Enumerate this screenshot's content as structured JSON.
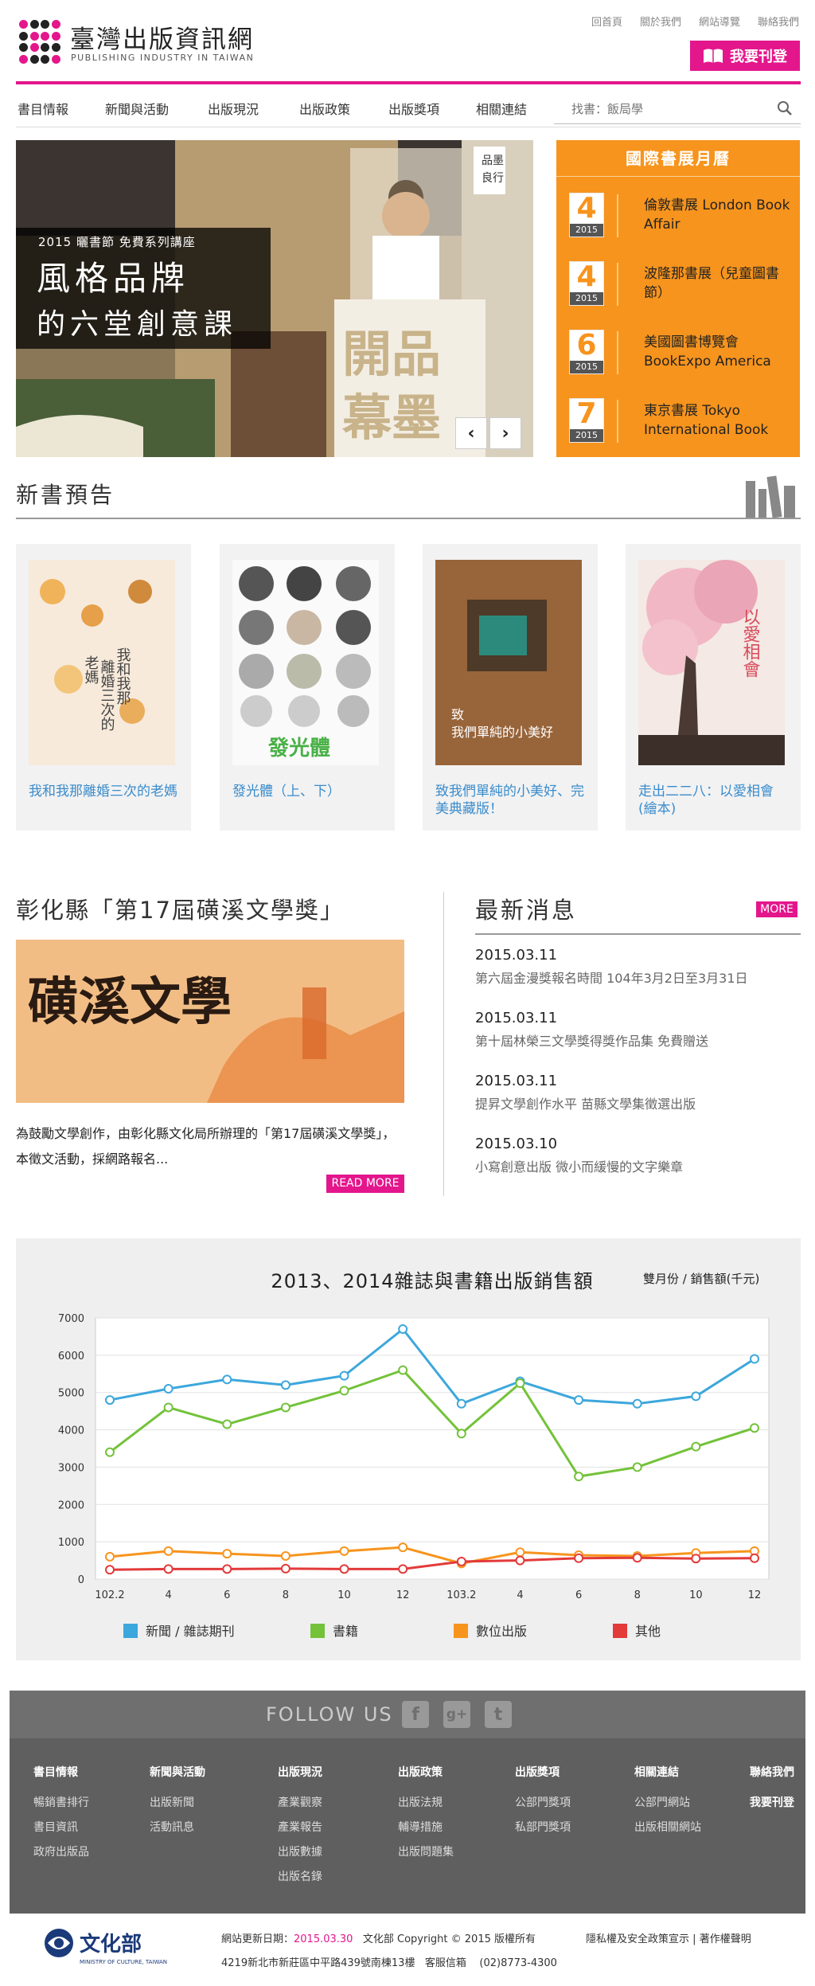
{
  "header": {
    "title": "臺灣出版資訊網",
    "subtitle": "PUBLISHING INDUSTRY IN TAIWAN",
    "toplinks": [
      "回首頁",
      "關於我們",
      "網站導覽",
      "聯絡我們"
    ],
    "subscribe_label": "我要刊登",
    "brand_color": "#e4168c"
  },
  "nav": {
    "items": [
      "書目情報",
      "新聞與活動",
      "出版現況",
      "出版政策",
      "出版獎項",
      "相關連結"
    ],
    "search_placeholder": "找書：飯局學"
  },
  "hero": {
    "tag": "2015 曬書節 免費系列講座",
    "title_line1": "風格品牌",
    "title_line2": "的六堂創意課",
    "prev_label": "‹",
    "next_label": "›"
  },
  "book_fair": {
    "title": "國際書展月曆",
    "accent": "#f7941d",
    "items": [
      {
        "month": "4",
        "year": "2015",
        "name": "倫敦書展 London Book Affair"
      },
      {
        "month": "4",
        "year": "2015",
        "name": "波隆那書展（兒童圖書節）"
      },
      {
        "month": "6",
        "year": "2015",
        "name": "美國圖書博覽會 BookExpo America"
      },
      {
        "month": "7",
        "year": "2015",
        "name": "東京書展 Tokyo International Book"
      }
    ]
  },
  "new_books": {
    "title": "新書預告",
    "items": [
      {
        "caption": "我和我那離婚三次的老媽"
      },
      {
        "caption": "發光體（上、下）"
      },
      {
        "caption": "致我們單純的小美好、完美典藏版！"
      },
      {
        "caption": "走出二二八：以愛相會(繪本)"
      }
    ]
  },
  "award": {
    "title": "彰化縣「第17屆磺溪文學獎」",
    "image_text": "磺溪文學",
    "text": "為鼓勵文學創作，由彰化縣文化局所辦理的「第17屆磺溪文學獎」，本徵文活動，採網路報名...",
    "more_label": "READ MORE"
  },
  "news": {
    "title": "最新消息",
    "more_label": "MORE",
    "items": [
      {
        "date": "2015.03.11",
        "text": "第六屆金漫獎報名時間 104年3月2日至3月31日"
      },
      {
        "date": "2015.03.11",
        "text": "第十屆林榮三文學獎得獎作品集 免費贈送"
      },
      {
        "date": "2015.03.11",
        "text": "提昇文學創作水平 苗縣文學集徵選出版"
      },
      {
        "date": "2015.03.10",
        "text": "小寫創意出版 微小而緩慢的文字樂章"
      }
    ]
  },
  "chart_data": {
    "type": "line",
    "title": "2013、2014雜誌與書籍出版銷售額",
    "unit_label": "雙月份 / 銷售額(千元)",
    "x": [
      "102.2",
      "4",
      "6",
      "8",
      "10",
      "12",
      "103.2",
      "4",
      "6",
      "8",
      "10",
      "12"
    ],
    "ylim": [
      0,
      7000
    ],
    "yticks": [
      0,
      1000,
      2000,
      3000,
      4000,
      5000,
      6000,
      7000
    ],
    "grid": true,
    "legend_position": "bottom",
    "series": [
      {
        "name": "新聞 / 雜誌期刊",
        "color": "#3ca7dc",
        "values": [
          4800,
          5100,
          5350,
          5200,
          5450,
          6700,
          4700,
          5300,
          4800,
          4700,
          4900,
          5900
        ]
      },
      {
        "name": "書籍",
        "color": "#73c23a",
        "values": [
          3400,
          4600,
          4150,
          4600,
          5050,
          5600,
          3900,
          5250,
          2750,
          3000,
          3550,
          4050
        ]
      },
      {
        "name": "數位出版",
        "color": "#f7941d",
        "values": [
          600,
          750,
          680,
          620,
          750,
          850,
          420,
          720,
          640,
          620,
          700,
          750
        ]
      },
      {
        "name": "其他",
        "color": "#e33a3a",
        "values": [
          250,
          270,
          270,
          280,
          270,
          270,
          470,
          500,
          560,
          570,
          550,
          560
        ]
      }
    ]
  },
  "footer": {
    "follow_label": "FOLLOW US",
    "social": [
      "f",
      "g+",
      "t"
    ],
    "columns": [
      {
        "heading": "書目情報",
        "links": [
          "暢銷書排行",
          "書目資訊",
          "政府出版品"
        ]
      },
      {
        "heading": "新聞與活動",
        "links": [
          "出版新聞",
          "活動訊息"
        ]
      },
      {
        "heading": "出版現況",
        "links": [
          "產業觀察",
          "產業報告",
          "出版數據",
          "出版名錄"
        ]
      },
      {
        "heading": "出版政策",
        "links": [
          "出版法規",
          "輔導措施",
          "出版問題集"
        ]
      },
      {
        "heading": "出版獎項",
        "links": [
          "公部門獎項",
          "私部門獎項"
        ]
      },
      {
        "heading": "相關連結",
        "links": [
          "公部門網站",
          "出版相關網站"
        ]
      },
      {
        "heading": "聯絡我們",
        "links": [
          "我要刊登"
        ]
      }
    ]
  },
  "bottom": {
    "org_name": "文化部",
    "org_en": "MINISTRY OF CULTURE, TAIWAN",
    "updated_label": "網站更新日期：",
    "updated_date": "2015.03.30",
    "copyright": "文化部 Copyright © 2015 版權所有",
    "privacy": "隱私權及安全政策宣示",
    "sep": "|",
    "copyright_notice": "著作權聲明",
    "address": "4219新北市新莊區中平路439號南棟13樓",
    "phone_label": "客服信箱",
    "phone": "(02)8773-4300"
  }
}
